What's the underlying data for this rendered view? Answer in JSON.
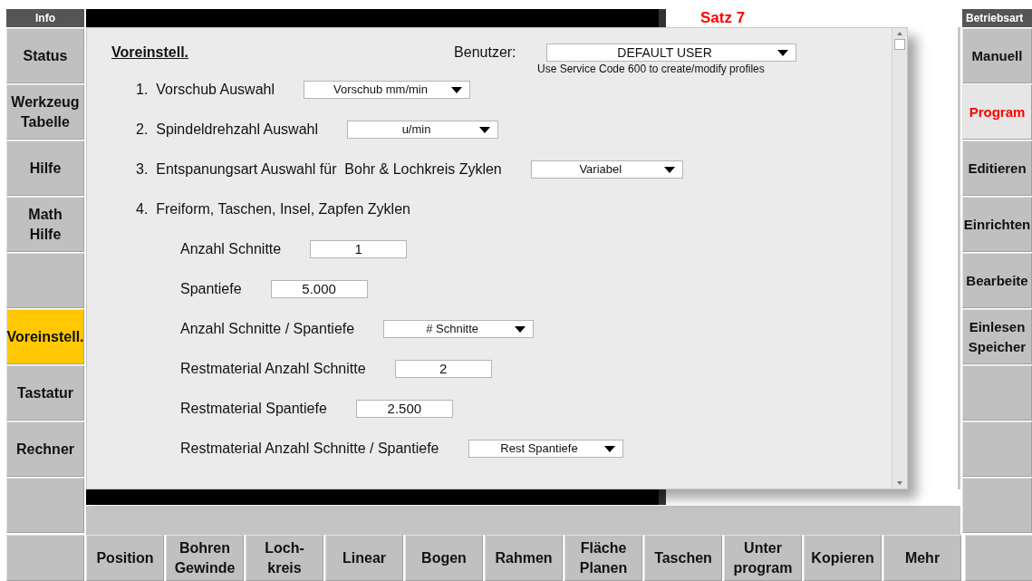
{
  "left_panel": {
    "header": "Info",
    "buttons": [
      {
        "kind": "key",
        "label": "Status",
        "selected": false
      },
      {
        "kind": "key",
        "label": "Werkzeug\nTabelle",
        "selected": false
      },
      {
        "kind": "key",
        "label": "Hilfe",
        "selected": false
      },
      {
        "kind": "key",
        "label": "Math\nHilfe",
        "selected": false
      },
      {
        "kind": "blank"
      },
      {
        "kind": "key",
        "label": "Voreinstell.",
        "selected": true
      },
      {
        "kind": "key",
        "label": "Tastatur",
        "selected": false
      },
      {
        "kind": "key",
        "label": "Rechner",
        "selected": false
      },
      {
        "kind": "blank"
      }
    ]
  },
  "program_view": {
    "block_label": "Satz 7"
  },
  "dialog": {
    "title": "Voreinstell.",
    "user_label": "Benutzer:",
    "user_select": "DEFAULT USER",
    "note": "Use Service Code 600 to create/modify profiles",
    "settings": [
      {
        "kind": "select",
        "number": "1.",
        "label": "Vorschub Auswahl",
        "value": "Vorschub mm/min"
      },
      {
        "kind": "select",
        "number": "2.",
        "label": "Spindeldrehzahl Auswahl",
        "value": "u/min"
      },
      {
        "kind": "select",
        "number": "3.",
        "label": "Entspanungsart Auswahl für  Bohr & Lochkreis Zyklen",
        "value": "Variabel"
      },
      {
        "kind": "heading",
        "number": "4.",
        "label": "Freiform, Taschen, Insel, Zapfen Zyklen",
        "children": [
          {
            "kind": "field",
            "label": "Anzahl Schnitte",
            "value": "1"
          },
          {
            "kind": "field",
            "label": "Spantiefe",
            "value": "5.000"
          },
          {
            "kind": "select",
            "label": "Anzahl Schnitte / Spantiefe",
            "value": "# Schnitte"
          },
          {
            "kind": "field",
            "label": "Restmaterial Anzahl Schnitte",
            "value": "2"
          },
          {
            "kind": "field",
            "label": "Restmaterial Spantiefe",
            "value": "2.500"
          },
          {
            "kind": "select",
            "label": "Restmaterial Anzahl Schnitte / Spantiefe",
            "value": "Rest Spantiefe"
          }
        ]
      }
    ]
  },
  "right_panel": {
    "header": "Betriebsart",
    "buttons": [
      {
        "kind": "key",
        "label": "Manuell",
        "selected": false
      },
      {
        "kind": "key",
        "label": "Program",
        "selected": true
      },
      {
        "kind": "key",
        "label": "Editieren",
        "selected": false
      },
      {
        "kind": "key",
        "label": "Einrichten",
        "selected": false
      },
      {
        "kind": "key",
        "label": "Bearbeite",
        "selected": false
      },
      {
        "kind": "key",
        "label": "Einlesen\nSpeicher",
        "selected": false
      },
      {
        "kind": "blank"
      },
      {
        "kind": "blank"
      },
      {
        "kind": "blank"
      }
    ]
  },
  "bottom_bar": {
    "buttons": [
      {
        "kind": "blank"
      },
      {
        "kind": "key",
        "label": "Position"
      },
      {
        "kind": "key",
        "label": "Bohren\nGewinde"
      },
      {
        "kind": "key",
        "label": "Loch-\nkreis"
      },
      {
        "kind": "key",
        "label": "Linear"
      },
      {
        "kind": "key",
        "label": "Bogen"
      },
      {
        "kind": "key",
        "label": "Rahmen"
      },
      {
        "kind": "key",
        "label": "Fläche\nPlanen"
      },
      {
        "kind": "key",
        "label": "Taschen"
      },
      {
        "kind": "key",
        "label": "Unter\nprogram"
      },
      {
        "kind": "key",
        "label": "Kopieren"
      },
      {
        "kind": "key",
        "label": "Mehr"
      },
      {
        "kind": "blank"
      }
    ]
  }
}
